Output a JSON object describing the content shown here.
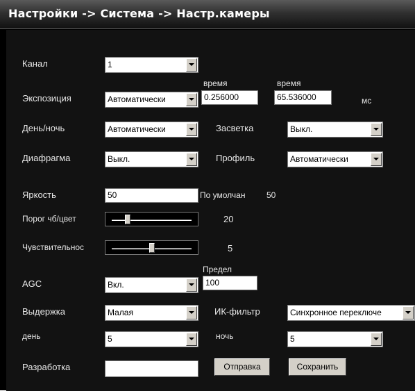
{
  "title": "Настройки -> Система -> Настр.камеры",
  "channel": {
    "label": "Канал",
    "value": "1"
  },
  "exposure": {
    "label": "Экспозиция",
    "mode": "Автоматически",
    "time_label_1": "время",
    "time_1": "0.256000",
    "time_label_2": "время",
    "time_2": "65.536000",
    "unit": "мс"
  },
  "day_night": {
    "label": "День/ночь",
    "value": "Автоматически"
  },
  "backlight": {
    "label": "Засветка",
    "value": "Выкл."
  },
  "iris": {
    "label": "Диафрагма",
    "value": "Выкл."
  },
  "profile": {
    "label": "Профиль",
    "value": "Автоматически"
  },
  "brightness": {
    "label": "Яркость",
    "value": "50",
    "default_label": "По умолчан",
    "default_value": "50"
  },
  "bw_threshold": {
    "label": "Порог чб/цвет",
    "value": "20",
    "level": 0.2
  },
  "sensitivity": {
    "label": "Чувствительнос",
    "value": "5",
    "level": 0.5
  },
  "agc": {
    "label": "AGC",
    "value": "Вкл.",
    "limit_label": "Предел",
    "limit": "100"
  },
  "shutter": {
    "label": "Выдержка",
    "value": "Малая"
  },
  "ir_filter": {
    "label": "ИК-фильтр",
    "value": "Синхронное переключе"
  },
  "day": {
    "label": "день",
    "value": "5"
  },
  "night": {
    "label": "ночь",
    "value": "5"
  },
  "dev": {
    "label": "Разработка",
    "value": ""
  },
  "buttons": {
    "send": "Отправка",
    "save": "Сохранить"
  }
}
